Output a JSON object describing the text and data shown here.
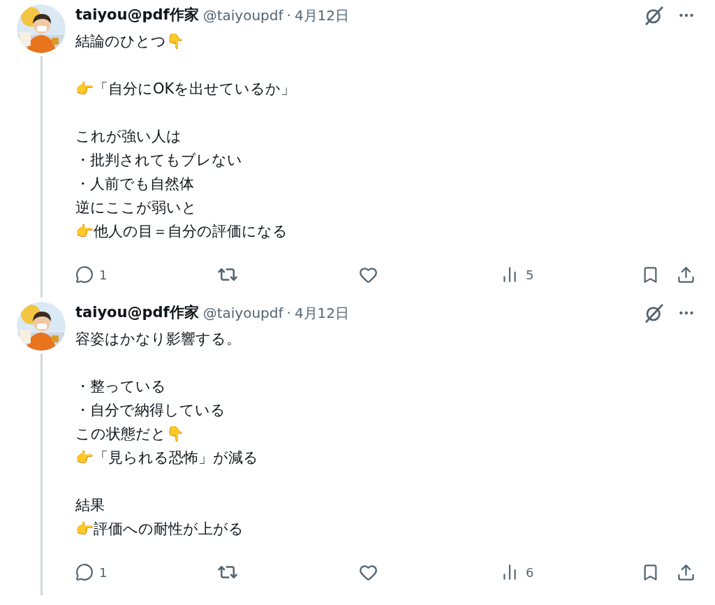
{
  "tweets": [
    {
      "author": {
        "name": "taiyou@pdf作家",
        "handle": "@taiyoupdf",
        "separator": "·",
        "date": "4月12日"
      },
      "thread_continues": true,
      "paragraphs": [
        [
          "結論のひとつ👇"
        ],
        [
          "👉「自分にOKを出せているか」"
        ],
        [
          "これが強い人は",
          "・批判されてもブレない",
          "・人前でも自然体",
          "逆にここが弱いと",
          "👉他人の目＝自分の評価になる"
        ]
      ],
      "actions": {
        "replies": "1",
        "views": "5"
      }
    },
    {
      "author": {
        "name": "taiyou@pdf作家",
        "handle": "@taiyoupdf",
        "separator": "·",
        "date": "4月12日"
      },
      "thread_continues": true,
      "paragraphs": [
        [
          "容姿はかなり影響する。"
        ],
        [
          "・整っている",
          "・自分で納得している",
          "この状態だと👇",
          "👉「見られる恐怖」が減る"
        ],
        [
          "結果",
          "👉評価への耐性が上がる"
        ]
      ],
      "actions": {
        "replies": "1",
        "views": "6"
      }
    }
  ]
}
